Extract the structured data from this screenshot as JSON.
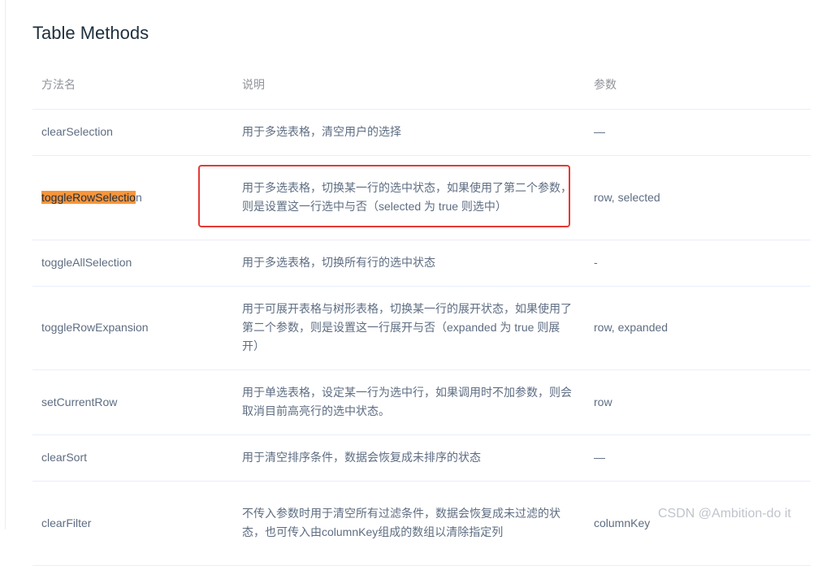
{
  "page": {
    "title": "Table Methods"
  },
  "table": {
    "headers": {
      "name": "方法名",
      "description": "说明",
      "params": "参数"
    },
    "rows": [
      {
        "name": "clearSelection",
        "description": "用于多选表格，清空用户的选择",
        "params": "—"
      },
      {
        "name_highlighted": "toggleRowSelectio",
        "name_rest": "n",
        "description": "用于多选表格，切换某一行的选中状态，如果使用了第二个参数，则是设置这一行选中与否（selected 为 true 则选中）",
        "params": "row, selected"
      },
      {
        "name": "toggleAllSelection",
        "description": "用于多选表格，切换所有行的选中状态",
        "params": "-"
      },
      {
        "name": "toggleRowExpansion",
        "description": "用于可展开表格与树形表格，切换某一行的展开状态，如果使用了第二个参数，则是设置这一行展开与否（expanded 为 true 则展开）",
        "params": "row, expanded"
      },
      {
        "name": "setCurrentRow",
        "description": "用于单选表格，设定某一行为选中行，如果调用时不加参数，则会取消目前高亮行的选中状态。",
        "params": "row"
      },
      {
        "name": "clearSort",
        "description": "用于清空排序条件，数据会恢复成未排序的状态",
        "params": "—"
      },
      {
        "name": "clearFilter",
        "description": "不传入参数时用于清空所有过滤条件，数据会恢复成未过滤的状态，也可传入由columnKey组成的数组以清除指定列",
        "params": "columnKey"
      }
    ]
  },
  "colors": {
    "highlight": "#f7953a",
    "annotation_border": "#e53935",
    "text": "#5e6d82",
    "header_text": "#909399",
    "title_text": "#1f2f3d"
  },
  "watermark": "CSDN @Ambition-do it"
}
